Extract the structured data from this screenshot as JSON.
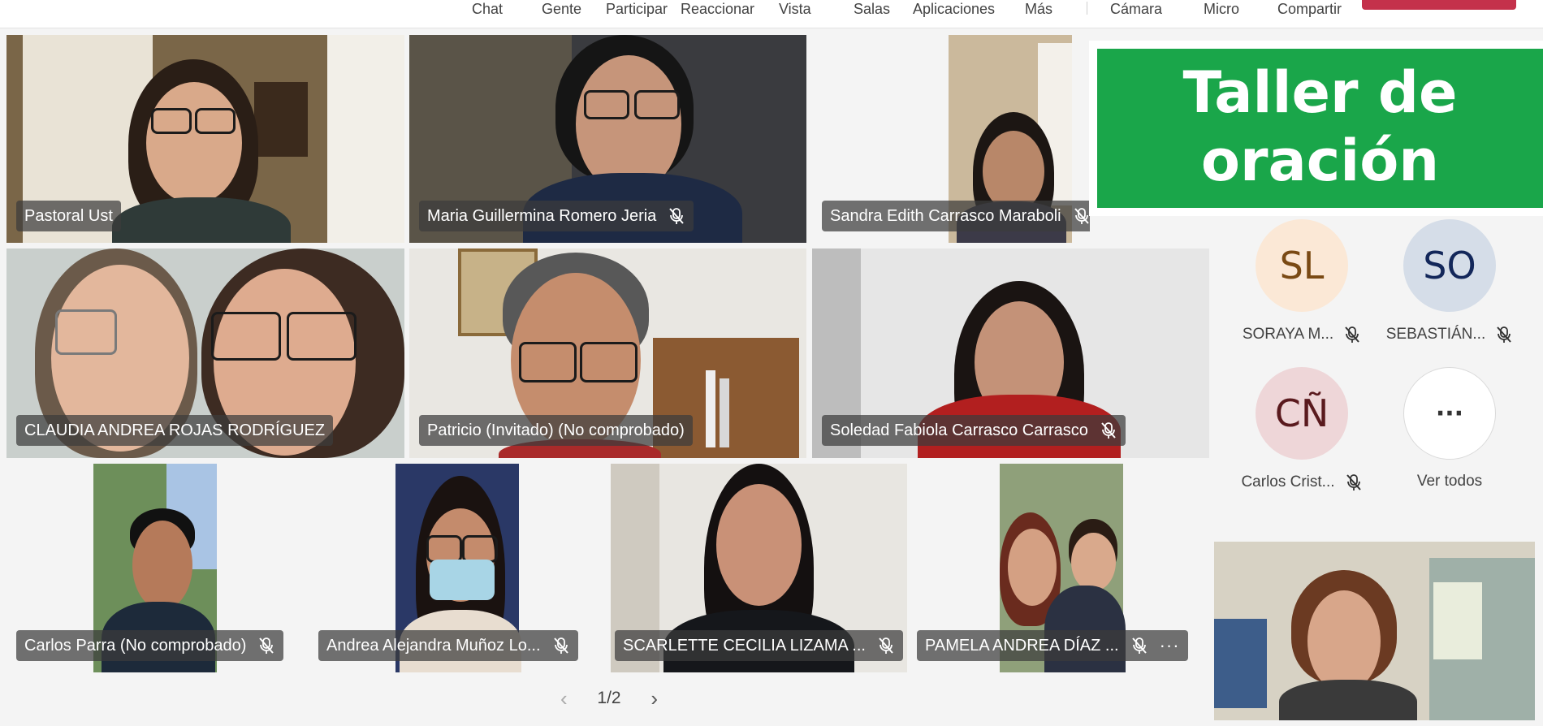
{
  "toolbar": {
    "items": [
      "Chat",
      "Gente",
      "Participar",
      "Reaccionar",
      "Vista",
      "Salas",
      "Aplicaciones",
      "Más",
      "Cámara",
      "Micro",
      "Compartir"
    ]
  },
  "tiles": [
    {
      "name": "Pastoral Ust",
      "muted": false
    },
    {
      "name": "Maria Guillermina Romero Jeria",
      "muted": true
    },
    {
      "name": "Sandra Edith Carrasco Maraboli",
      "muted": true
    },
    {
      "name": "CLAUDIA ANDREA ROJAS RODRÍGUEZ",
      "muted": false
    },
    {
      "name": "Patricio (Invitado) (No comprobado)",
      "muted": false
    },
    {
      "name": "Soledad Fabiola Carrasco Carrasco",
      "muted": true
    },
    {
      "name": "Carlos Parra (No comprobado)",
      "muted": true
    },
    {
      "name": "Andrea Alejandra Muñoz Lo...",
      "muted": true
    },
    {
      "name": "SCARLETTE CECILIA LIZAMA ...",
      "muted": true
    },
    {
      "name": "PAMELA ANDREA DÍAZ ...",
      "muted": true
    }
  ],
  "banner": {
    "line1": "Taller de",
    "line2": "oración",
    "color": "#1aa64a"
  },
  "avatars": [
    {
      "initials": "SL",
      "name": "SORAYA M...",
      "bg": "#fbe8d6",
      "fg": "#7a4a14"
    },
    {
      "initials": "SO",
      "name": "SEBASTIÁN...",
      "bg": "#d5dde8",
      "fg": "#13275a"
    },
    {
      "initials": "CÑ",
      "name": "Carlos Crist...",
      "bg": "#eed6d8",
      "fg": "#5a1a1e"
    },
    {
      "initials": "···",
      "name": "Ver todos",
      "bg": "#ffffff",
      "fg": "#333333"
    }
  ],
  "pager": {
    "label": "1/2"
  }
}
